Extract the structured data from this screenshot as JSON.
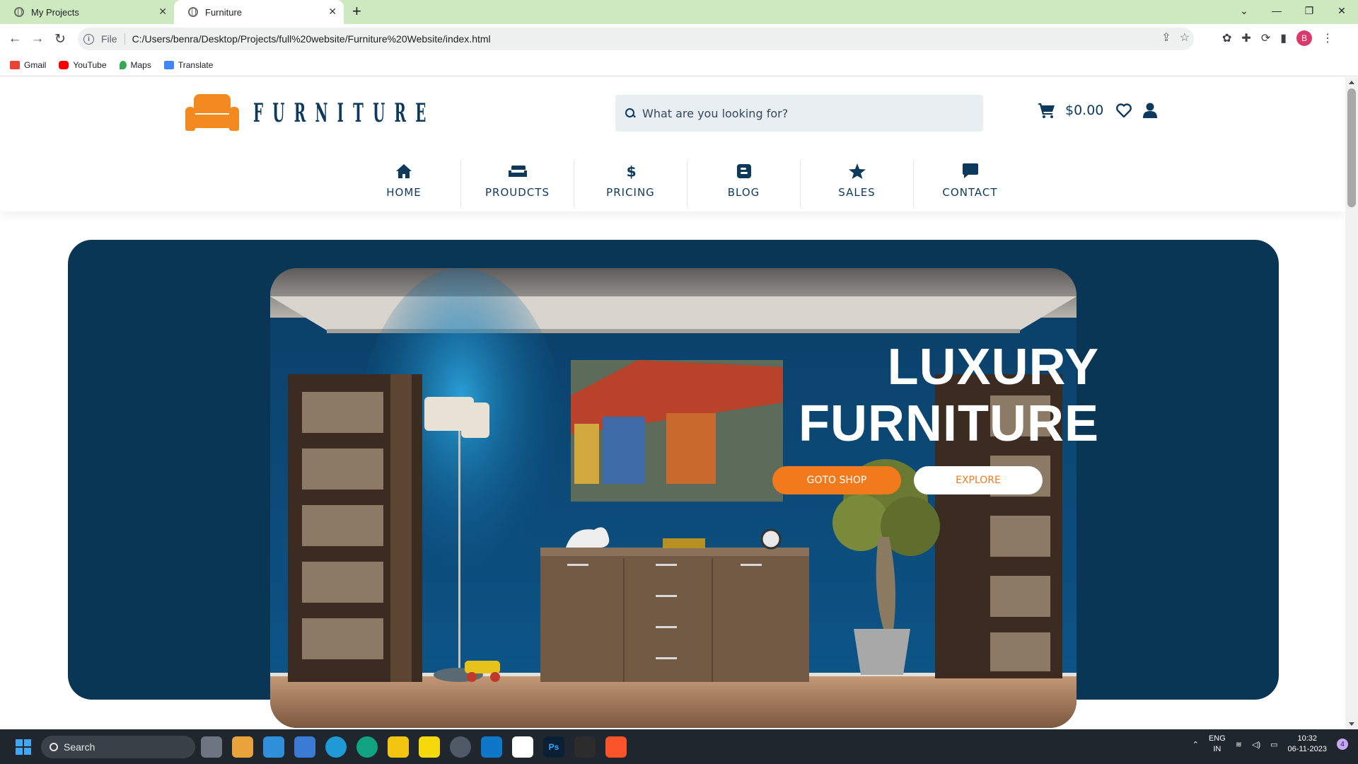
{
  "browser": {
    "tabs": [
      {
        "title": "My Projects",
        "active": false
      },
      {
        "title": "Furniture",
        "active": true
      }
    ],
    "address": {
      "scheme": "File",
      "url": "C:/Users/benra/Desktop/Projects/full%20website/Furniture%20Website/index.html"
    },
    "profile_initial": "B",
    "bookmarks": [
      "Gmail",
      "YouTube",
      "Maps",
      "Translate"
    ]
  },
  "site": {
    "logo_text": "FURNITURE",
    "search": {
      "placeholder": "What are you looking for?"
    },
    "cart_total": "$0.00",
    "nav": [
      {
        "label": "HOME",
        "icon": "home-icon"
      },
      {
        "label": "PROUDCTS",
        "icon": "sofa-icon"
      },
      {
        "label": "PRICING",
        "icon": "dollar-icon"
      },
      {
        "label": "BLOG",
        "icon": "blog-icon"
      },
      {
        "label": "SALES",
        "icon": "star-icon"
      },
      {
        "label": "CONTACT",
        "icon": "chat-icon"
      }
    ],
    "hero": {
      "title_line1": "LUXURY",
      "title_line2": "FURNITURE",
      "primary_button": "GOTO SHOP",
      "secondary_button": "EXPLORE"
    },
    "colors": {
      "brand_orange": "#f28a1f",
      "brand_navy": "#0a3656"
    }
  },
  "taskbar": {
    "search_label": "Search",
    "language": "ENG",
    "region": "IN",
    "time": "10:32",
    "date": "06-11-2023",
    "notification_count": "4"
  }
}
